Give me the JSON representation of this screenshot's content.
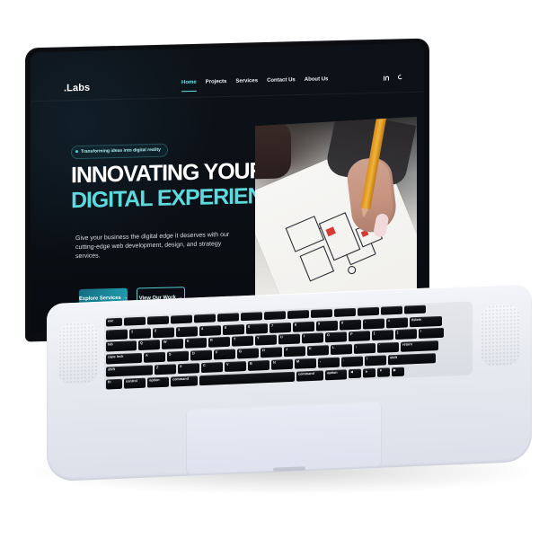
{
  "brand": {
    "logo": ".Labs"
  },
  "nav": {
    "items": [
      {
        "label": "Home",
        "active": true
      },
      {
        "label": "Projects",
        "active": false
      },
      {
        "label": "Services",
        "active": false
      },
      {
        "label": "Contact Us",
        "active": false
      },
      {
        "label": "About Us",
        "active": false
      }
    ],
    "icons": [
      "linkedin-icon",
      "moon-icon"
    ]
  },
  "hero": {
    "badge": "Transforming ideas into digital reality",
    "title_line_1": "INNOVATING YOUR",
    "title_line_2": "DIGITAL EXPERIENCES",
    "subtitle": "Give your business the digital edge it deserves with our cutting-edge web development, design, and strategy services.",
    "primary_button": "Explore Services →",
    "secondary_button": "View Our Work →"
  },
  "colors": {
    "accent": "#5ed9dd",
    "primary_button": "#1f9aaa",
    "screen_bg": "#0b1016"
  },
  "keyboard": {
    "rows": [
      [
        "esc",
        "",
        "",
        "",
        "",
        "",
        "",
        "",
        "",
        "",
        "",
        "",
        "",
        ""
      ],
      [
        "`",
        "1",
        "2",
        "3",
        "4",
        "5",
        "6",
        "7",
        "8",
        "9",
        "0",
        "-",
        "=",
        "delete"
      ],
      [
        "tab",
        "Q",
        "W",
        "E",
        "R",
        "T",
        "Y",
        "U",
        "I",
        "O",
        "P",
        "[",
        "]",
        "\\"
      ],
      [
        "caps lock",
        "A",
        "S",
        "D",
        "F",
        "G",
        "H",
        "J",
        "K",
        "L",
        ";",
        "'",
        "return"
      ],
      [
        "shift",
        "Z",
        "X",
        "C",
        "V",
        "B",
        "N",
        "M",
        ",",
        ".",
        "/",
        "shift"
      ],
      [
        "fn",
        "control",
        "option",
        "command",
        "",
        "command",
        "option",
        "◀",
        "▲",
        "▼",
        "▶"
      ]
    ]
  }
}
